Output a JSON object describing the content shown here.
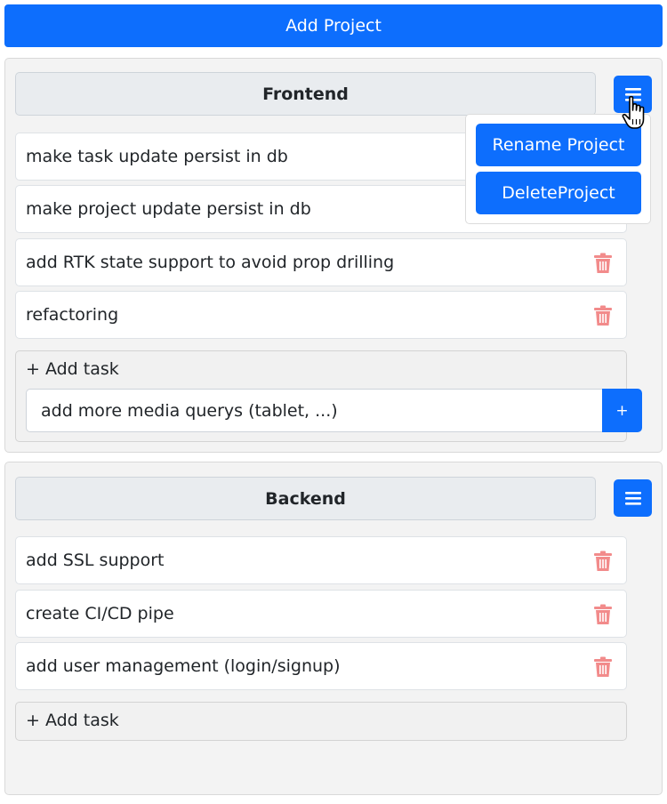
{
  "toolbar": {
    "add_project_label": "Add Project"
  },
  "projects": [
    {
      "title": "Frontend",
      "tasks": [
        {
          "text": "make task update persist in db"
        },
        {
          "text": "make project update persist in db"
        },
        {
          "text": "add RTK state support to avoid prop drilling"
        },
        {
          "text": "refactoring"
        }
      ],
      "add_task_label": "+ Add task",
      "new_task_value": "add more media querys (tablet, ...)",
      "new_task_button": "+",
      "menu": {
        "rename_label": "Rename Project",
        "delete_label": "DeleteProject"
      }
    },
    {
      "title": "Backend",
      "tasks": [
        {
          "text": "add SSL support"
        },
        {
          "text": "create CI/CD pipe"
        },
        {
          "text": "add user management (login/signup)"
        }
      ],
      "add_task_label": "+ Add task"
    }
  ],
  "icons": {
    "menu": "hamburger-menu-icon",
    "delete": "trash-icon",
    "cursor": "hand-pointer-icon"
  },
  "colors": {
    "primary": "#0d6efd",
    "trash": "#f28b8b",
    "card_bg": "#f3f3f3",
    "title_bg": "#e9ecef"
  }
}
